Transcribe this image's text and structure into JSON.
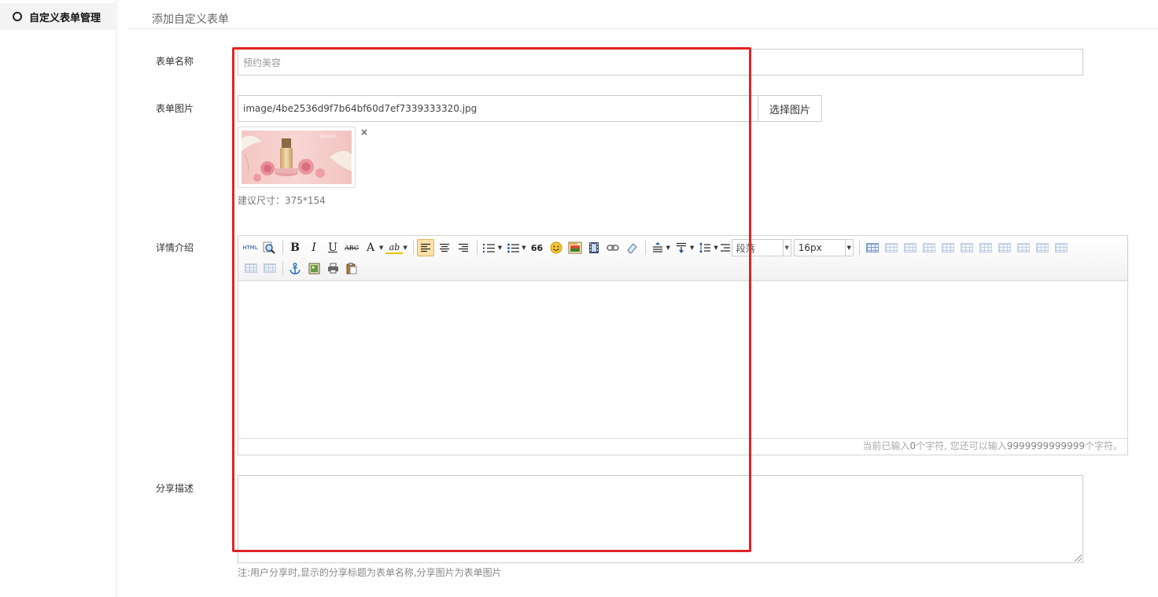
{
  "sidebar": {
    "items": [
      {
        "label": "自定义表单管理"
      }
    ]
  },
  "page": {
    "title": "添加自定义表单"
  },
  "form": {
    "name_label": "表单名称",
    "name_value": "预约美容",
    "image_label": "表单图片",
    "image_path": "image/4be2536d9f7b64bf60d7ef7339333320.jpg",
    "choose_image_button": "选择图片",
    "remove_icon": "×",
    "size_hint": "建议尺寸：375*154",
    "detail_label": "详情介绍",
    "share_label": "分享描述",
    "share_value": "",
    "share_note": "注:用户分享时,显示的分享标题为表单名称,分享图片为表单图片"
  },
  "editor": {
    "toolbar": {
      "html": "HTML",
      "bold": "B",
      "italic": "I",
      "underline": "U",
      "strike": "ABC",
      "fontcolor": "A",
      "highlight": "ab",
      "quote": "66",
      "paragraph_select": "段落",
      "fontsize_select": "16px"
    },
    "counter": {
      "prefix": "当前已输入",
      "count": "0",
      "mid": "个字符, 您还可以输入",
      "remaining": "9999999999999",
      "suffix": "个字符。"
    }
  },
  "colors": {
    "highlight_box": "#e02424",
    "active_button": "#fbe0a8"
  }
}
